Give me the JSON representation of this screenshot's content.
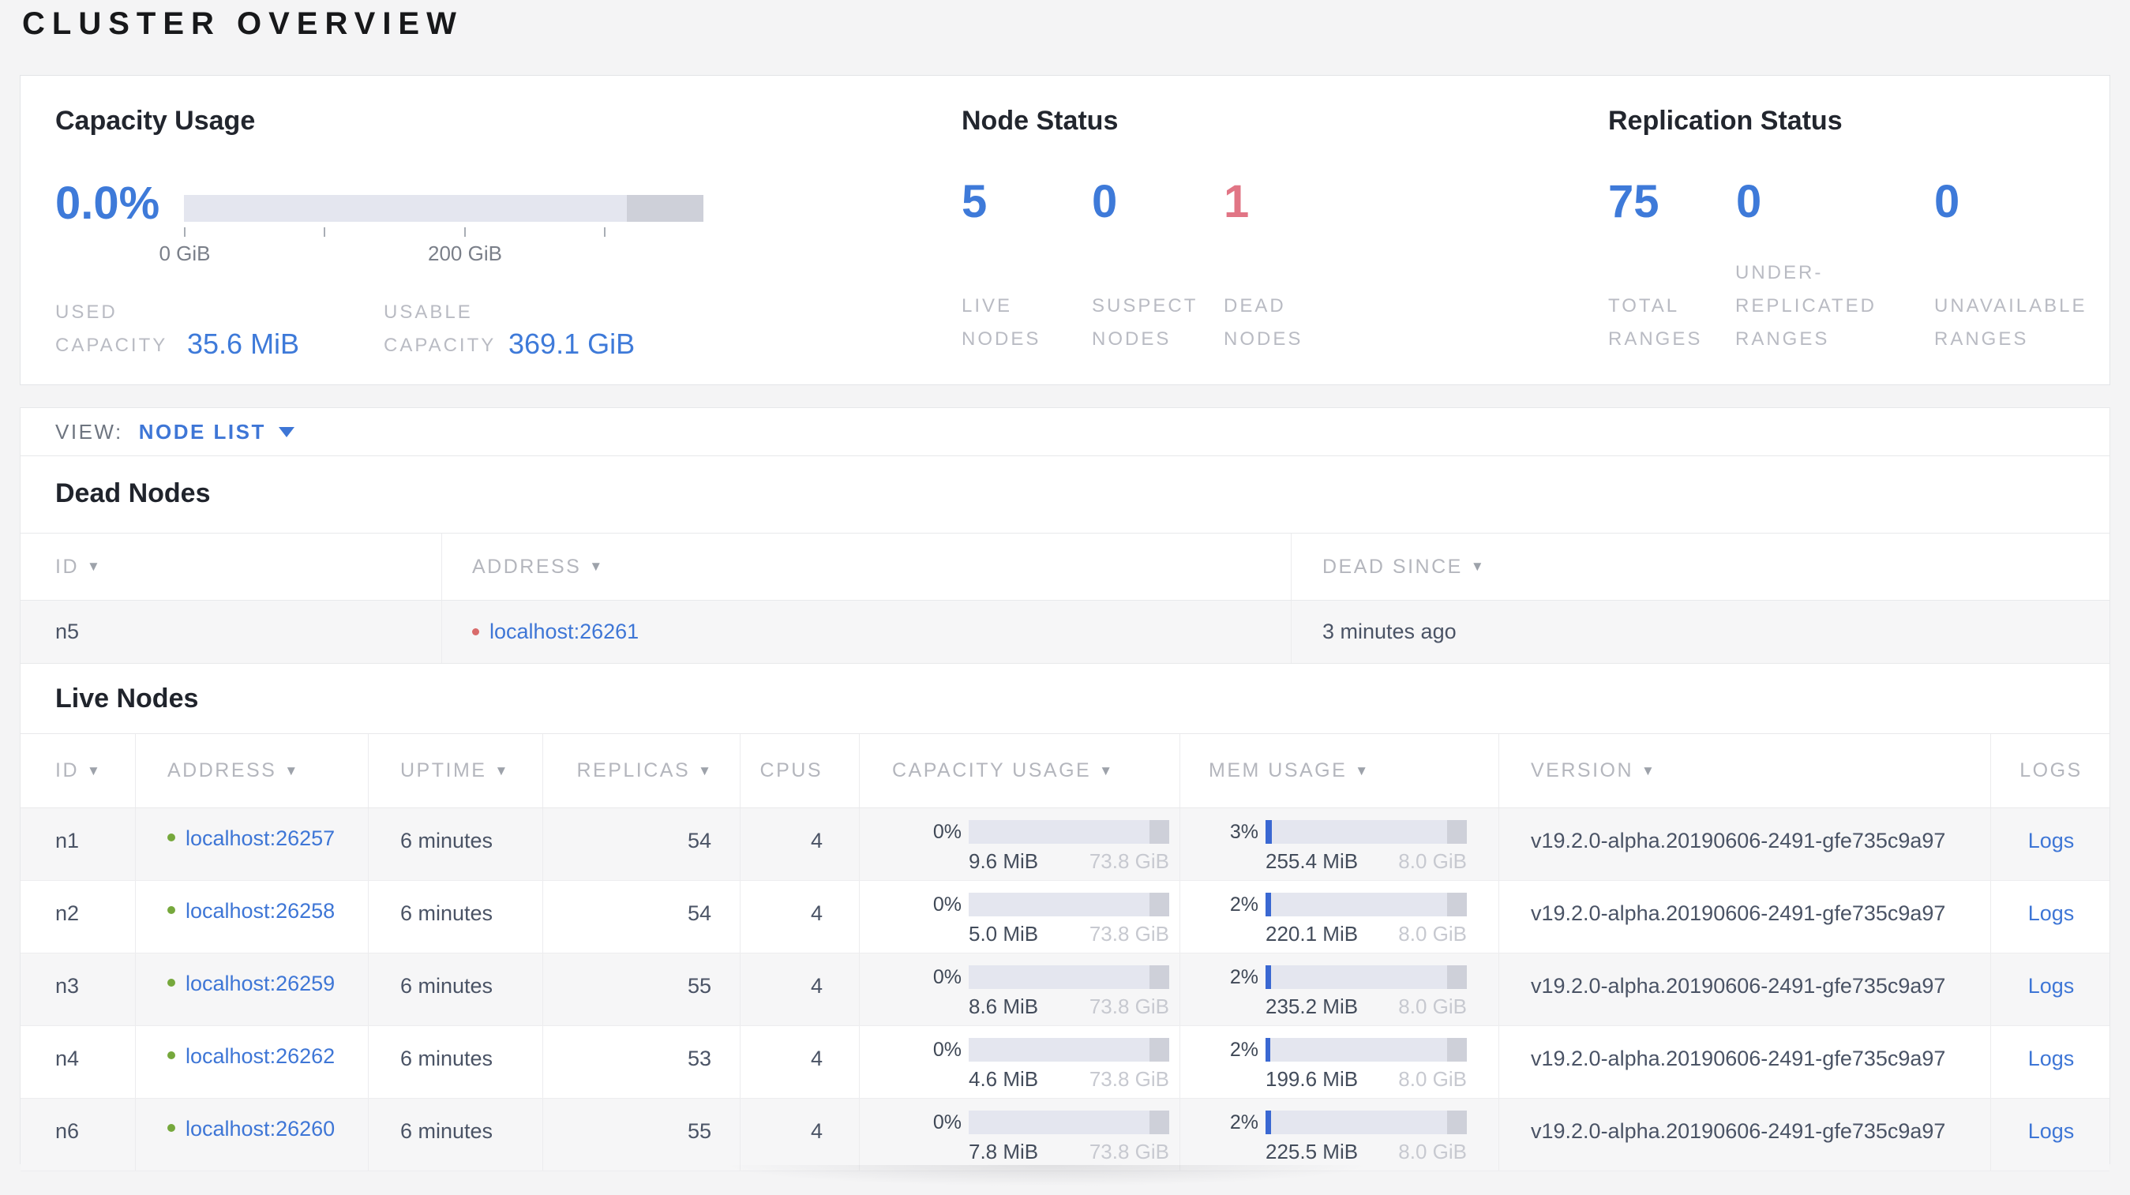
{
  "page": {
    "title": "CLUSTER OVERVIEW"
  },
  "icons": {
    "sort_desc": "▼",
    "dropdown": "▾"
  },
  "colors": {
    "accent_blue": "#3e76d6",
    "danger_red": "#e17585",
    "live_green": "#76a83c",
    "dead_dot_red": "#d96b6b"
  },
  "summary": {
    "capacity": {
      "title": "Capacity Usage",
      "percent": "0.0%",
      "axis": [
        "0 GiB",
        "200 GiB"
      ],
      "used": {
        "line1": "USED",
        "line2": "CAPACITY",
        "value": "35.6 MiB"
      },
      "usable": {
        "line1": "USABLE",
        "line2": "CAPACITY",
        "value": "369.1 GiB"
      }
    },
    "node_status": {
      "title": "Node Status",
      "stats": [
        {
          "value": "5",
          "label": [
            "LIVE",
            "NODES"
          ]
        },
        {
          "value": "0",
          "label": [
            "SUSPECT",
            "NODES"
          ]
        },
        {
          "value": "1",
          "label": [
            "DEAD",
            "NODES"
          ]
        }
      ]
    },
    "replication": {
      "title": "Replication Status",
      "stats": [
        {
          "value": "75",
          "label": [
            "TOTAL",
            "RANGES"
          ]
        },
        {
          "value": "0",
          "label": [
            "UNDER-",
            "REPLICATED",
            "RANGES"
          ]
        },
        {
          "value": "0",
          "label": [
            "UNAVAILABLE",
            "RANGES"
          ]
        }
      ]
    }
  },
  "view_bar": {
    "label": "VIEW:",
    "selected": "NODE LIST"
  },
  "dead_nodes": {
    "title": "Dead Nodes",
    "columns": [
      "ID",
      "ADDRESS",
      "DEAD SINCE"
    ],
    "rows": [
      {
        "id": "n5",
        "address": "localhost:26261",
        "dead_since": "3 minutes ago"
      }
    ]
  },
  "live_nodes": {
    "title": "Live Nodes",
    "columns": [
      {
        "label": "ID",
        "sorted": true
      },
      {
        "label": "ADDRESS",
        "sorted": true
      },
      {
        "label": "UPTIME",
        "sorted": true
      },
      {
        "label": "REPLICAS",
        "sorted": true
      },
      {
        "label": "CPUS",
        "sorted": false
      },
      {
        "label": "CAPACITY USAGE",
        "sorted": true
      },
      {
        "label": "MEM USAGE",
        "sorted": true
      },
      {
        "label": "VERSION",
        "sorted": true
      },
      {
        "label": "LOGS",
        "sorted": false
      }
    ],
    "rows": [
      {
        "id": "n1",
        "address": "localhost:26257",
        "uptime": "6 minutes",
        "replicas": "54",
        "cpus": "4",
        "capacity": {
          "pct": "0%",
          "pct_num": 0,
          "used": "9.6 MiB",
          "total": "73.8 GiB"
        },
        "mem": {
          "pct": "3%",
          "pct_num": 3,
          "used": "255.4 MiB",
          "total": "8.0 GiB"
        },
        "version": "v19.2.0-alpha.20190606-2491-gfe735c9a97",
        "logs": "Logs"
      },
      {
        "id": "n2",
        "address": "localhost:26258",
        "uptime": "6 minutes",
        "replicas": "54",
        "cpus": "4",
        "capacity": {
          "pct": "0%",
          "pct_num": 0,
          "used": "5.0 MiB",
          "total": "73.8 GiB"
        },
        "mem": {
          "pct": "2%",
          "pct_num": 2.7,
          "used": "220.1 MiB",
          "total": "8.0 GiB"
        },
        "version": "v19.2.0-alpha.20190606-2491-gfe735c9a97",
        "logs": "Logs"
      },
      {
        "id": "n3",
        "address": "localhost:26259",
        "uptime": "6 minutes",
        "replicas": "55",
        "cpus": "4",
        "capacity": {
          "pct": "0%",
          "pct_num": 0,
          "used": "8.6 MiB",
          "total": "73.8 GiB"
        },
        "mem": {
          "pct": "2%",
          "pct_num": 2.9,
          "used": "235.2 MiB",
          "total": "8.0 GiB"
        },
        "version": "v19.2.0-alpha.20190606-2491-gfe735c9a97",
        "logs": "Logs"
      },
      {
        "id": "n4",
        "address": "localhost:26262",
        "uptime": "6 minutes",
        "replicas": "53",
        "cpus": "4",
        "capacity": {
          "pct": "0%",
          "pct_num": 0,
          "used": "4.6 MiB",
          "total": "73.8 GiB"
        },
        "mem": {
          "pct": "2%",
          "pct_num": 2.4,
          "used": "199.6 MiB",
          "total": "8.0 GiB"
        },
        "version": "v19.2.0-alpha.20190606-2491-gfe735c9a97",
        "logs": "Logs"
      },
      {
        "id": "n6",
        "address": "localhost:26260",
        "uptime": "6 minutes",
        "replicas": "55",
        "cpus": "4",
        "capacity": {
          "pct": "0%",
          "pct_num": 0,
          "used": "7.8 MiB",
          "total": "73.8 GiB"
        },
        "mem": {
          "pct": "2%",
          "pct_num": 2.8,
          "used": "225.5 MiB",
          "total": "8.0 GiB"
        },
        "version": "v19.2.0-alpha.20190606-2491-gfe735c9a97",
        "logs": "Logs"
      }
    ]
  }
}
